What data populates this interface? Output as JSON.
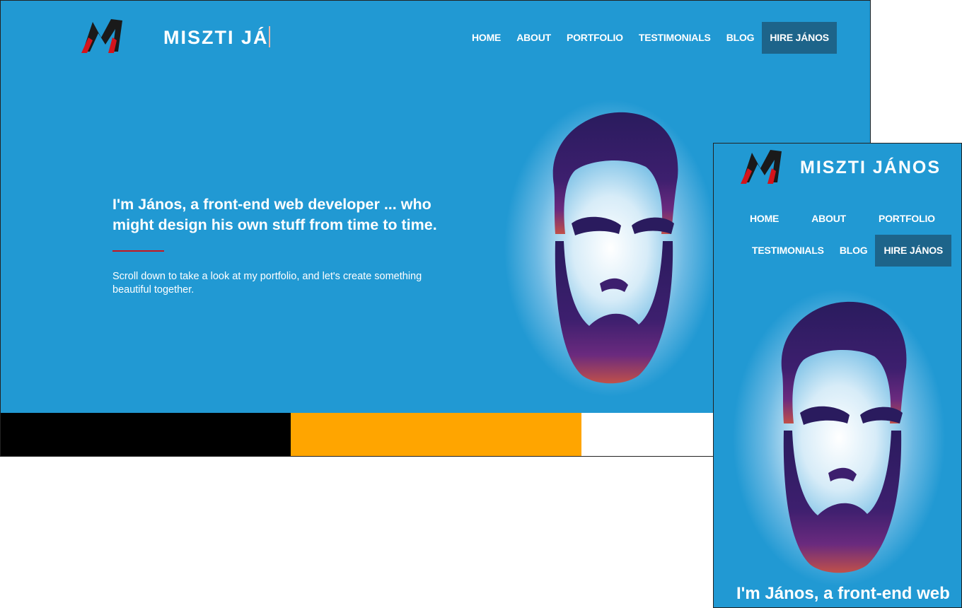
{
  "site": {
    "title_partial": "MISZTI JÁ",
    "title_full": "MISZTI JÁNOS"
  },
  "nav": {
    "items": [
      "HOME",
      "ABOUT",
      "PORTFOLIO",
      "TESTIMONIALS",
      "BLOG",
      "HIRE JÁNOS"
    ]
  },
  "hero": {
    "headline_line1": "I'm János, a front-end web developer ... who",
    "headline_line2": "might design his own stuff from time to time.",
    "subtext_line1": "Scroll down to take a look at my portfolio, and let's create something",
    "subtext_line2": "beautiful together.",
    "mobile_headline": "I'm János, a front-end web"
  },
  "colors": {
    "hero_bg": "#2199d3",
    "hire_bg": "#1d648a",
    "accent_red": "#c8141d",
    "swatch_1": "#000000",
    "swatch_2": "#ffa500",
    "swatch_3": "#ffffff"
  },
  "icons": {
    "logo": "m-monogram-logo",
    "portrait": "bearded-face-portrait"
  }
}
